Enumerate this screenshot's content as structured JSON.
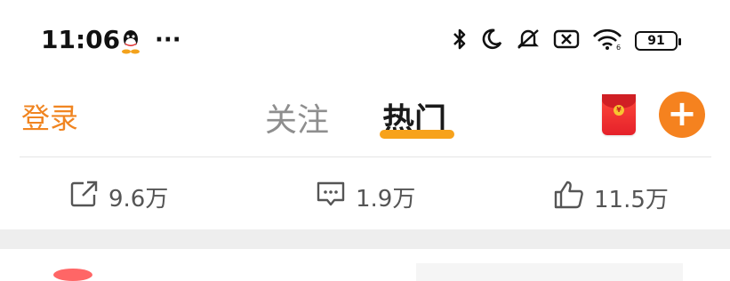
{
  "status_bar": {
    "time": "11:06",
    "more": "···",
    "battery_level": "91",
    "icons": [
      "qq-penguin-icon",
      "bluetooth-icon",
      "moon-icon",
      "mute-icon",
      "sim-off-icon",
      "wifi-6-icon",
      "battery-icon"
    ]
  },
  "header": {
    "login_label": "登录",
    "tabs": [
      {
        "label": "关注",
        "active": false
      },
      {
        "label": "热门",
        "active": true
      }
    ],
    "accent_color": "#f5821f"
  },
  "actions": {
    "share_count": "9.6万",
    "comment_count": "1.9万",
    "like_count": "11.5万"
  }
}
